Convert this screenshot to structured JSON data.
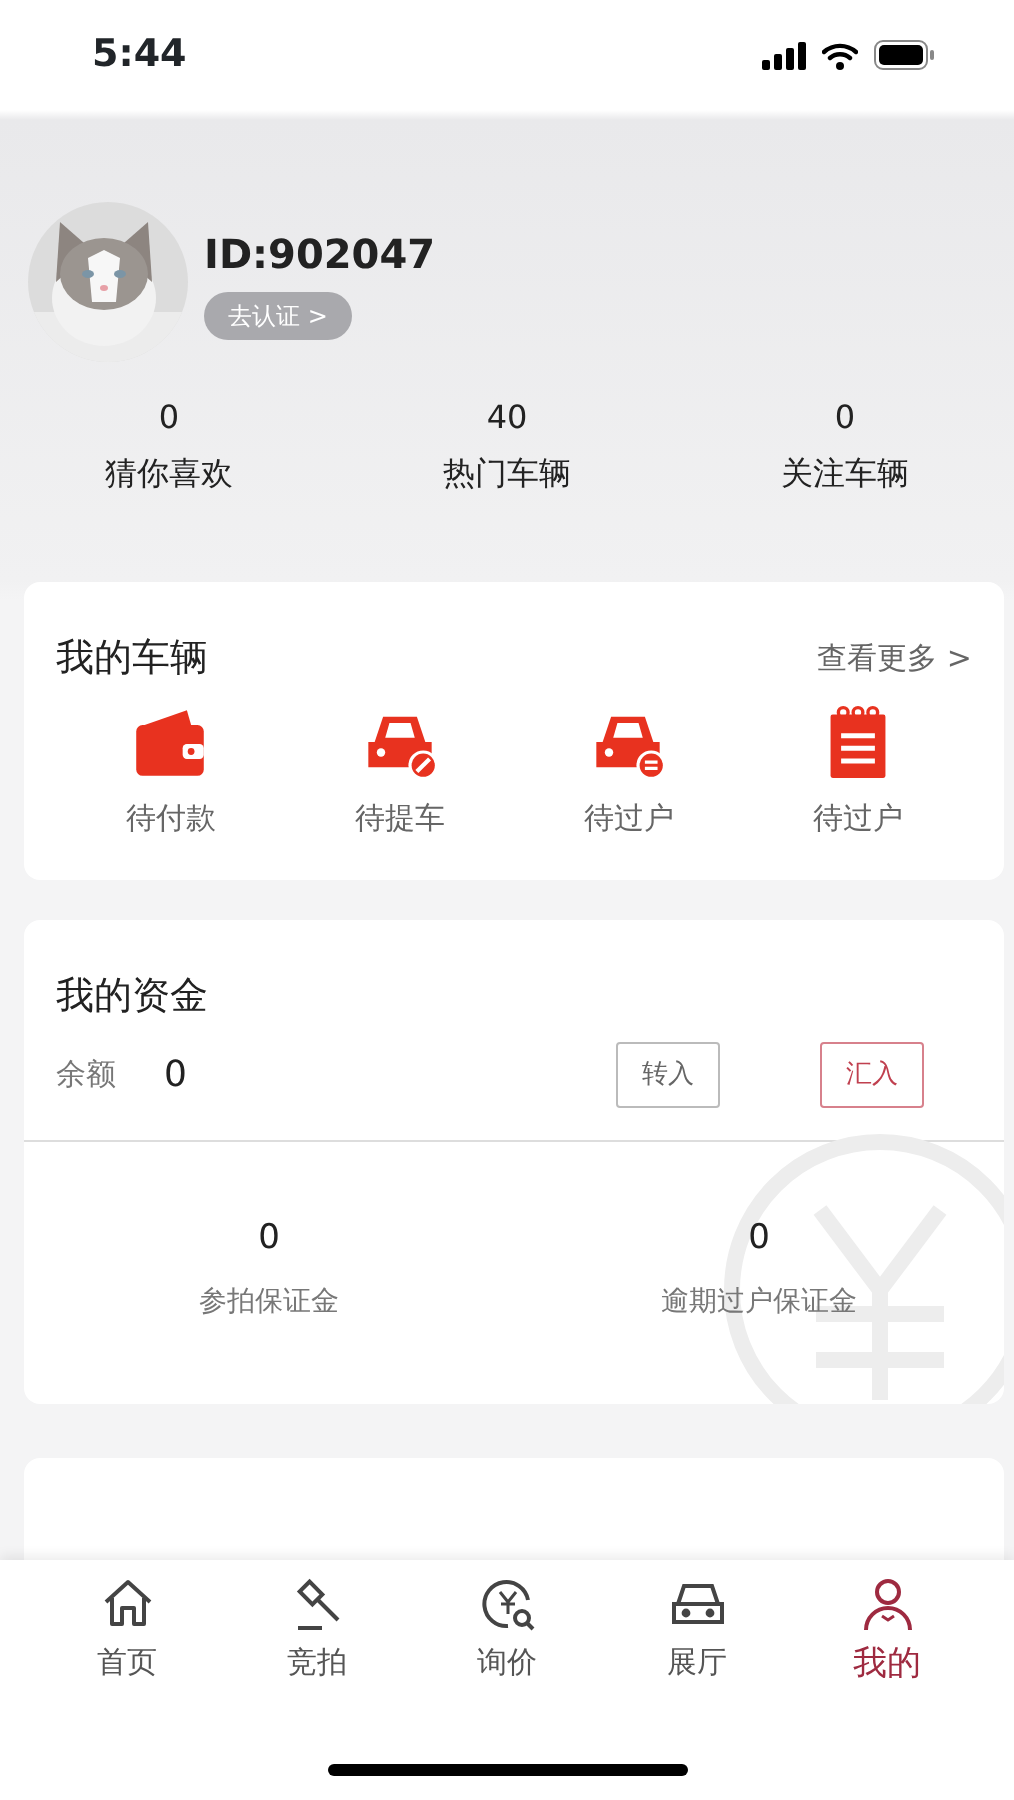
{
  "status_bar": {
    "time": "5:44"
  },
  "profile": {
    "id": "ID:902047",
    "verify_button": "去认证 >"
  },
  "stats": [
    {
      "value": "0",
      "label": "猜你喜欢"
    },
    {
      "value": "40",
      "label": "热门车辆"
    },
    {
      "value": "0",
      "label": "关注车辆"
    }
  ],
  "vehicles": {
    "title": "我的车辆",
    "more": "查看更多 >",
    "items": [
      {
        "label": "待付款",
        "kind": "wallet"
      },
      {
        "label": "待提车",
        "kind": "car-pickup"
      },
      {
        "label": "待过户",
        "kind": "car-transfer"
      },
      {
        "label": "待过户",
        "kind": "notepad"
      }
    ]
  },
  "funds": {
    "title": "我的资金",
    "balance_label": "余额",
    "balance": "0",
    "buttons": [
      {
        "label": "转入",
        "kind": "plain"
      },
      {
        "label": "汇入",
        "kind": "accent"
      }
    ],
    "deposits": [
      {
        "value": "0",
        "label": "参拍保证金"
      },
      {
        "value": "0",
        "label": "逾期过户保证金"
      }
    ]
  },
  "tabs": [
    {
      "label": "首页",
      "kind": "home",
      "selected": false
    },
    {
      "label": "竞拍",
      "kind": "auction",
      "selected": false
    },
    {
      "label": "询价",
      "kind": "price",
      "selected": false
    },
    {
      "label": "展厅",
      "kind": "showroom",
      "selected": false
    },
    {
      "label": "我的",
      "kind": "me",
      "selected": true
    }
  ]
}
